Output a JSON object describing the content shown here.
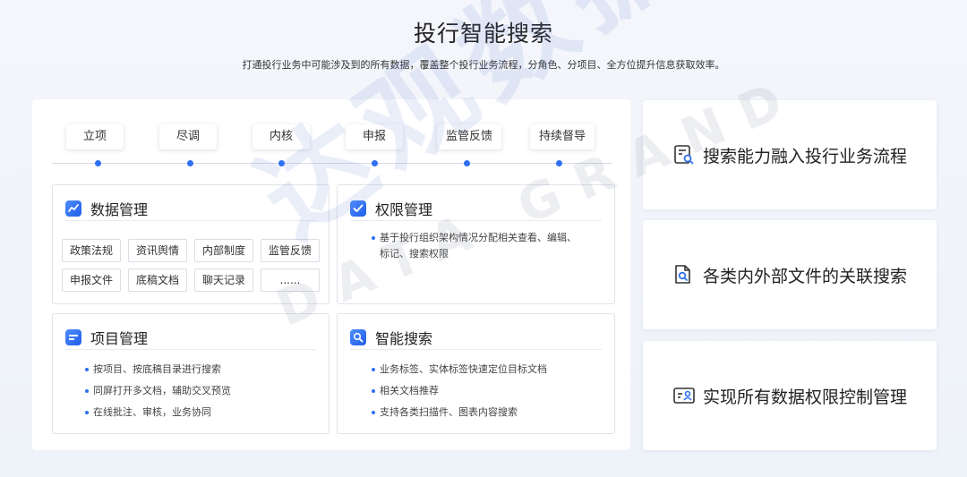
{
  "header": {
    "title": "投行智能搜索",
    "subtitle": "打通投行业务中可能涉及到的所有数据，覆盖整个投行业务流程，分角色、分项目、全方位提升信息获取效率。"
  },
  "timeline": {
    "stages": [
      "立项",
      "尽调",
      "内核",
      "申报",
      "监管反馈",
      "持续督导"
    ]
  },
  "data_management": {
    "title": "数据管理",
    "icon": "chart-line-icon",
    "tags": [
      "政策法规",
      "资讯舆情",
      "内部制度",
      "监管反馈",
      "申报文件",
      "底稿文档",
      "聊天记录",
      "......"
    ]
  },
  "permission_management": {
    "title": "权限管理",
    "icon": "check-icon",
    "text": "基于投行组织架构情况分配相关查看、编辑、标记、搜索权限"
  },
  "project_management": {
    "title": "项目管理",
    "icon": "project-icon",
    "items": [
      "按项目、按底稿目录进行搜索",
      "同屏打开多文档，辅助交叉预览",
      "在线批注、审核，业务协同"
    ]
  },
  "smart_search": {
    "title": "智能搜索",
    "icon": "search-icon",
    "items": [
      "业务标签、实体标签快速定位目标文档",
      "相关文档推荐",
      "支持各类扫描件、图表内容搜索"
    ]
  },
  "features": [
    {
      "label": "搜索能力融入投行业务流程",
      "icon": "document-search-icon"
    },
    {
      "label": "各类内外部文件的关联搜索",
      "icon": "file-search-icon"
    },
    {
      "label": "实现所有数据权限控制管理",
      "icon": "user-permission-icon"
    }
  ],
  "watermark": {
    "cn": "达观数据",
    "en": "DATA GRAND"
  },
  "colors": {
    "accent": "#2f6ff3",
    "background": "#f4f6fb"
  }
}
